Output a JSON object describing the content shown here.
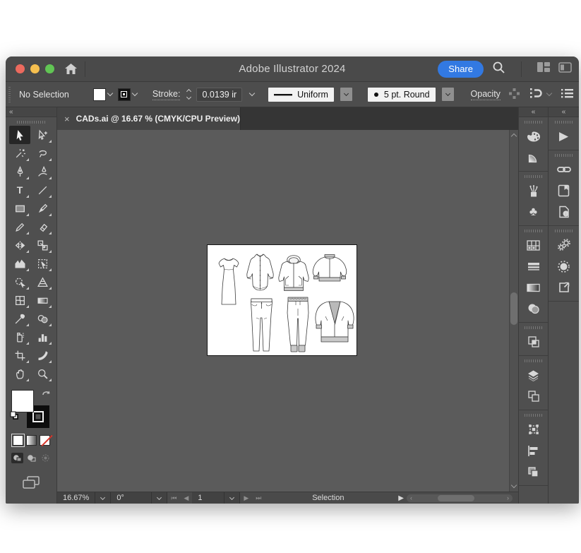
{
  "window": {
    "title": "Adobe Illustrator 2024"
  },
  "titlebar": {
    "share_label": "Share",
    "icons": [
      "home-icon",
      "search-icon",
      "workspace-switcher-icon",
      "panel-layout-icon"
    ]
  },
  "controlbar": {
    "selection_status": "No Selection",
    "stroke_label": "Stroke:",
    "stroke_value": "0.0139 ir",
    "width_profile_value": "Uniform",
    "brush_value": "5 pt. Round",
    "opacity_label": "Opacity",
    "right_icons": [
      "align-glyphs-icon",
      "snap-options-icon",
      "menu-list-icon"
    ]
  },
  "tab": {
    "close": "×",
    "title": "CADs.ai @ 16.67 % (CMYK/CPU Preview)"
  },
  "panels": {
    "collapse": "«"
  },
  "toolbar_tools": [
    "selection",
    "direct-selection",
    "magic-wand",
    "lasso",
    "pen",
    "curvature",
    "type",
    "line-segment",
    "rectangle",
    "paintbrush",
    "pencil",
    "eraser",
    "rotate",
    "scale",
    "width",
    "free-transform",
    "shape-builder",
    "perspective-grid",
    "mesh",
    "gradient",
    "eyedropper",
    "blend",
    "symbol-sprayer",
    "column-graph",
    "artboard",
    "slice",
    "hand",
    "zoom"
  ],
  "type_tool_glyph": "T",
  "right_panel_icons": {
    "inner": [
      "color",
      "color-guide",
      "brushes",
      "symbols",
      "swatches",
      "stroke",
      "gradient",
      "transparency",
      "pathfinder",
      "layers",
      "artboards",
      "transform",
      "align",
      "arrange"
    ],
    "outer": [
      "actions",
      "links",
      "libraries",
      "document-info",
      "asset-export",
      "image-trace",
      "export-for-screens"
    ]
  },
  "symbols_glyph": "♣",
  "actions_glyph": "▶",
  "statusbar": {
    "zoom": "16.67%",
    "rotation": "0°",
    "artboard_number": "1",
    "nav_first": "⏮",
    "nav_prev": "◀",
    "nav_next": "▶",
    "nav_last": "⏭",
    "tool_status": "Selection",
    "flyout": "▶",
    "scroll_left": "‹",
    "scroll_right": "›"
  },
  "artwork": {
    "garments": [
      "dress",
      "shirt",
      "hoodie",
      "bomber-jacket",
      "jeans",
      "joggers",
      "cardigan"
    ]
  },
  "colors": {
    "accent_blue": "#3279e2",
    "traffic_red": "#ec6a5e",
    "traffic_yellow": "#f5bf4f",
    "traffic_green": "#61c554",
    "canvas_gray": "#5b5b5b",
    "panel_gray": "#4f4f4f",
    "none_red": "#d8352a"
  }
}
